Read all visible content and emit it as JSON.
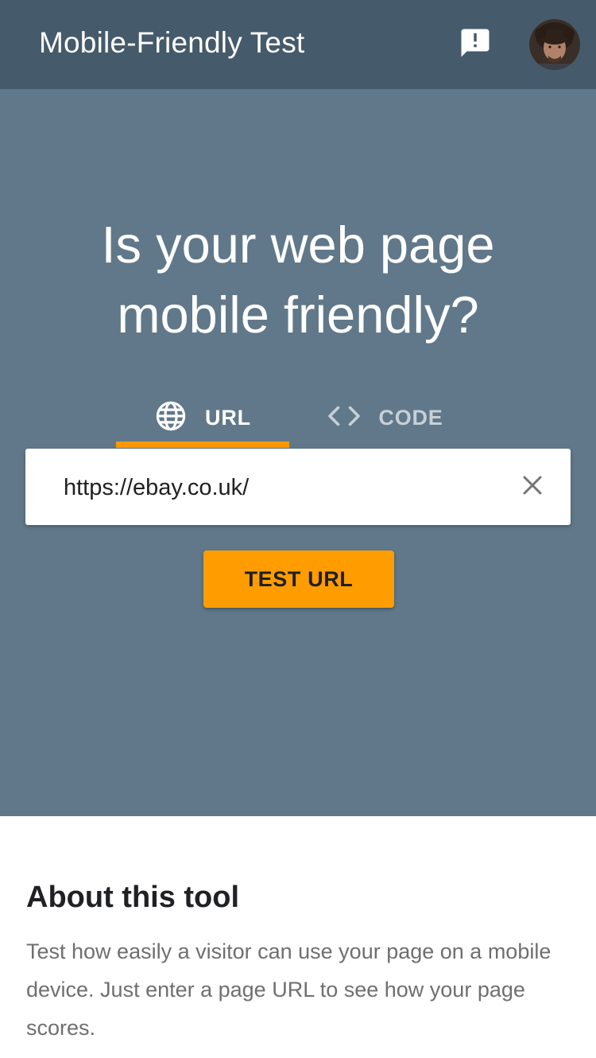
{
  "app": {
    "title": "Mobile-Friendly Test",
    "icons": {
      "feedback": "feedback-icon",
      "avatar": "user-avatar"
    }
  },
  "hero": {
    "title_line1": "Is your web page",
    "title_line2": "mobile friendly?"
  },
  "tabs": [
    {
      "label": "URL",
      "icon": "globe-icon",
      "selected": true
    },
    {
      "label": "CODE",
      "icon": "code-icon",
      "selected": false
    }
  ],
  "url_field": {
    "value": "https://ebay.co.uk/",
    "clear_icon": "close-icon"
  },
  "test_button": {
    "label": "TEST URL"
  },
  "about": {
    "heading": "About this tool",
    "body": "Test how easily a visitor can use your page on a mobile device. Just enter a page URL to see how your page scores."
  },
  "colors": {
    "topbar": "#455a6b",
    "hero": "#607889",
    "accent": "#ff9800",
    "button": "#ff9d00"
  }
}
